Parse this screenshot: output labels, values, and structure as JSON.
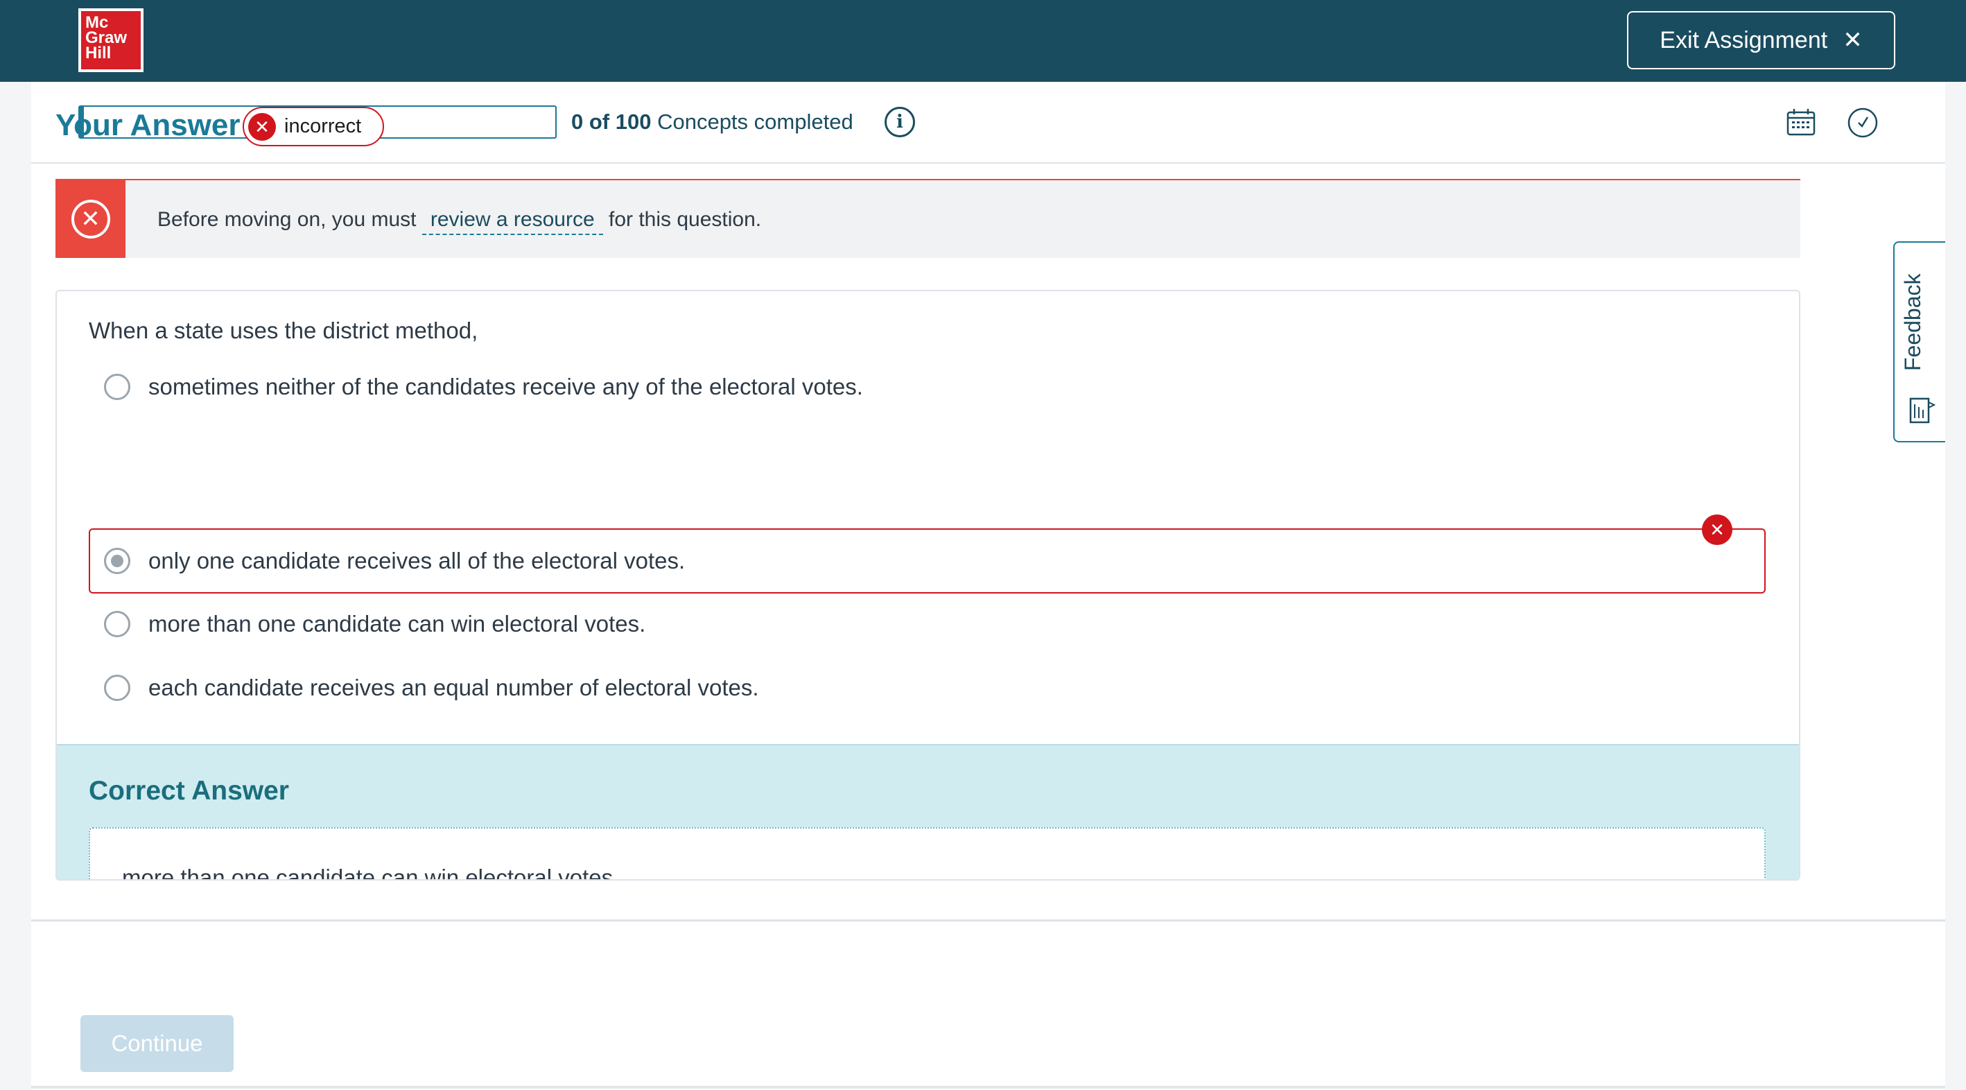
{
  "header": {
    "logo_lines": [
      "Mc",
      "Graw",
      "Hill"
    ],
    "exit_label": "Exit Assignment",
    "exit_icon": "close-icon"
  },
  "progress": {
    "completed": "0 of 100",
    "suffix": "Concepts completed",
    "fraction": 0.0,
    "info_icon": "info-icon",
    "calendar_icon": "calendar-icon",
    "clock_icon": "clock-icon"
  },
  "answer": {
    "heading": "Your Answer",
    "status": "incorrect"
  },
  "alert": {
    "before": "Before moving on, you must",
    "link": "review a resource",
    "after": "for this question."
  },
  "question": {
    "stem": "When a state uses the district method,",
    "options": [
      {
        "label": "sometimes neither of the candidates receive any of the electoral votes.",
        "selected": false
      },
      {
        "label": "only one candidate receives all of the electoral votes.",
        "selected": true,
        "status": "incorrect"
      },
      {
        "label": "more than one candidate can win electoral votes.",
        "selected": false
      },
      {
        "label": "each candidate receives an equal number of electoral votes.",
        "selected": false
      }
    ]
  },
  "correct": {
    "heading": "Correct Answer",
    "text": "more than one candidate can win electoral votes."
  },
  "footer": {
    "continue_label": "Continue"
  },
  "feedback": {
    "label": "Feedback"
  },
  "colors": {
    "header_bg": "#1a4c5f",
    "accent": "#1a7a98",
    "error": "#d0151c",
    "alert": "#e8483e",
    "correct_bg": "#d1ecf1"
  }
}
